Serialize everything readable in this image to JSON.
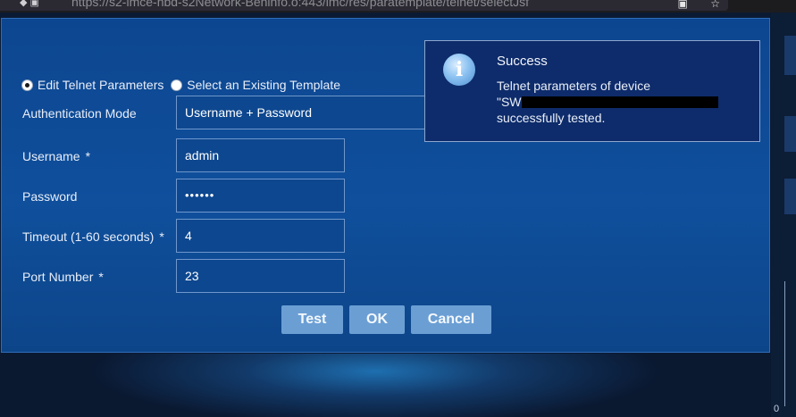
{
  "browser": {
    "url": "https://s2-imce-nbd-s2Network-Beninfo.o:443/imc/res/paratemplate/telnet/selectJsf"
  },
  "dialog": {
    "radio_edit_label": "Edit Telnet Parameters",
    "radio_template_label": "Select an Existing Template",
    "auth_mode_label": "Authentication Mode",
    "auth_mode_value": "Username + Password",
    "username_label": "Username",
    "username_value": "admin",
    "password_label": "Password",
    "password_value": "••••••",
    "timeout_label": "Timeout (1-60 seconds)",
    "timeout_value": "4",
    "port_label": "Port Number",
    "port_value": "23",
    "required_marker": "*",
    "test_label": "Test",
    "ok_label": "OK",
    "cancel_label": "Cancel"
  },
  "toast": {
    "icon": "info-icon",
    "title": "Success",
    "line1": "Telnet parameters of device",
    "line2_prefix": "\"SW",
    "line3": "successfully tested."
  },
  "backdrop": {
    "axis_zero": "0"
  },
  "colors": {
    "dialog_bg": "#0f4f9c",
    "button_bg": "#6b9fd4",
    "toast_bg": "#0e2c6b"
  }
}
